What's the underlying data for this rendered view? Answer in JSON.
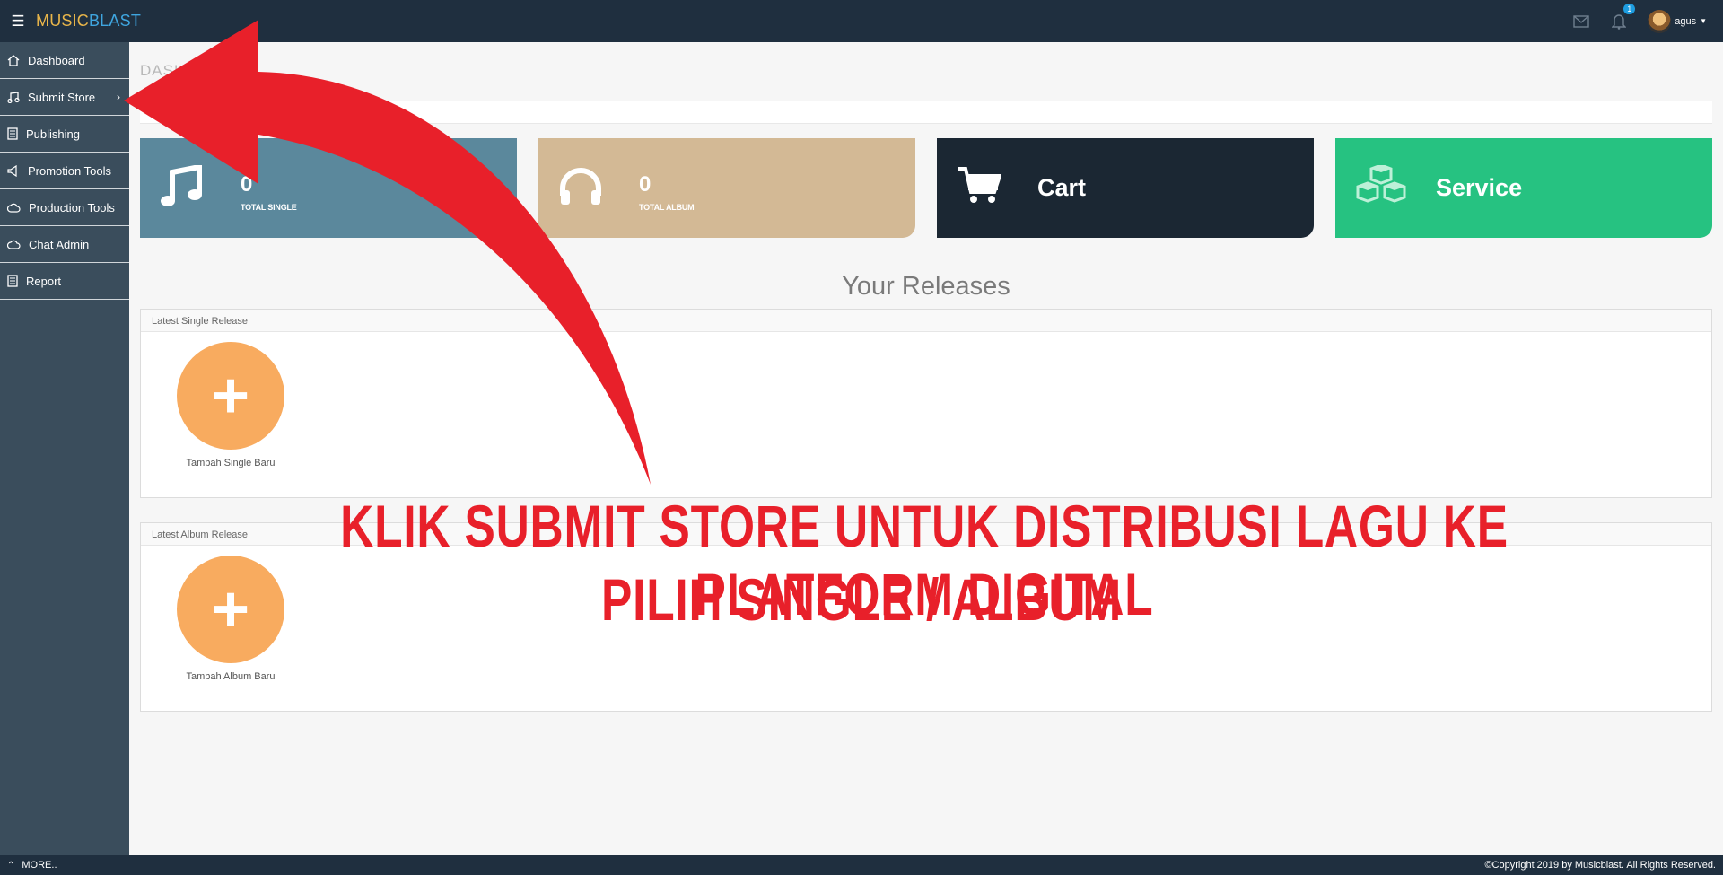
{
  "app": {
    "brand_part1": "MUSIC",
    "brand_part2": "BLAST"
  },
  "header": {
    "notification_count": "1",
    "user_name": "agus",
    "icons": [
      "menu-icon",
      "mail-icon",
      "bell-icon",
      "caret-down-icon"
    ]
  },
  "sidebar": {
    "items": [
      {
        "label": "Dashboard",
        "icon": "home-icon"
      },
      {
        "label": "Submit Store",
        "icon": "music-icon"
      },
      {
        "label": "Publishing",
        "icon": "document-icon"
      },
      {
        "label": "Promotion Tools",
        "icon": "megaphone-icon"
      },
      {
        "label": "Production Tools",
        "icon": "cloud-icon"
      },
      {
        "label": "Chat Admin",
        "icon": "cloud-icon"
      },
      {
        "label": "Report",
        "icon": "document-icon"
      }
    ]
  },
  "page": {
    "title": "DASH"
  },
  "cards": {
    "single": {
      "value": "0",
      "label": "TOTAL SINGLE"
    },
    "album": {
      "value": "0",
      "label": "TOTAL ALBUM"
    },
    "cart": {
      "title": "Cart"
    },
    "service": {
      "title": "Service"
    }
  },
  "releases": {
    "title": "Your Releases",
    "single_panel": {
      "heading": "Latest Single Release",
      "add_label": "Tambah Single Baru"
    },
    "album_panel": {
      "heading": "Latest Album Release",
      "add_label": "Tambah Album Baru"
    },
    "add_symbol": "+"
  },
  "annotation": {
    "line1": "KLIK SUBMIT STORE UNTUK DISTRIBUSI LAGU KE PLATFORM DIGITAL",
    "line2": "PILIH SINGLE / ALBUM"
  },
  "footer": {
    "more": "MORE..",
    "copyright": "©Copyright 2019 by Musicblast. All Rights Reserved."
  },
  "colors": {
    "topbar": "#1f2f3f",
    "sidebar": "#3a4d5c",
    "card_single": "#5b889c",
    "card_album": "#d3b995",
    "card_cart": "#1b2733",
    "card_service": "#26c281",
    "add_button": "#f8ab5f",
    "annotation": "#e8202a"
  }
}
